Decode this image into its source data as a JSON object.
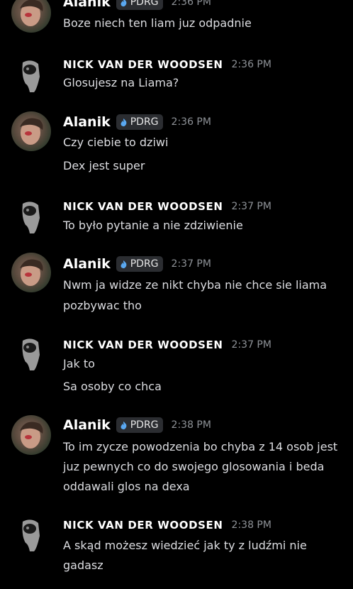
{
  "users": {
    "alanik": {
      "name": "Alanik",
      "tag": "PDRG"
    },
    "nick": {
      "name": "NICK VAN DER WOODSEN"
    }
  },
  "messages": [
    {
      "author": "Alanik",
      "time": "2:36 PM",
      "lines": [
        "Boze niech ten liam juz odpadnie"
      ]
    },
    {
      "author": "NICK VAN DER WOODSEN",
      "time": "2:36 PM",
      "lines": [
        "Glosujesz na Liama?"
      ]
    },
    {
      "author": "Alanik",
      "time": "2:36 PM",
      "lines": [
        "Czy ciebie to dziwi",
        "Dex jest super"
      ]
    },
    {
      "author": "NICK VAN DER WOODSEN",
      "time": "2:37 PM",
      "lines": [
        "To było pytanie a nie zdziwienie"
      ]
    },
    {
      "author": "Alanik",
      "time": "2:37 PM",
      "lines": [
        "Nwm ja widze ze nikt chyba nie chce sie liama",
        "pozbywac tho"
      ]
    },
    {
      "author": "NICK VAN DER WOODSEN",
      "time": "2:37 PM",
      "lines": [
        "Jak to",
        "Sa osoby co chca"
      ]
    },
    {
      "author": "Alanik",
      "time": "2:38 PM",
      "lines": [
        "To im zycze powodzenia bo chyba z 14 osob jest",
        "juz pewnych co do swojego glosowania i beda",
        "oddawali glos na dexa"
      ]
    },
    {
      "author": "NICK VAN DER WOODSEN",
      "time": "2:38 PM",
      "lines": [
        "A skąd możesz wiedzieć jak ty z ludźmi nie",
        "gadasz"
      ]
    }
  ],
  "colors": {
    "background": "#000000",
    "text": "#dcdde1",
    "timestamp": "#8e9297",
    "tag_bg": "#2b2d31",
    "tag_icon": "#5aa8f0"
  }
}
